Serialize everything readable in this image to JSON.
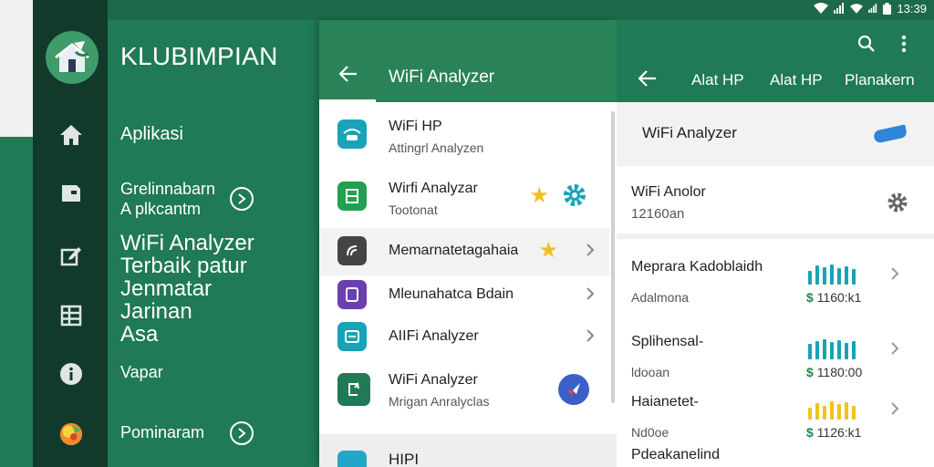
{
  "status_bar": {
    "time": "13:39"
  },
  "colors": {
    "primary": "#1f7a55",
    "dark_rail": "#123a2a",
    "star": "#f3c023",
    "teal": "#18a3b8"
  },
  "drawer": {
    "title": "KLUBIMPIAN",
    "aplikasi": "Aplikasi",
    "group1_line1": "Grelinnabarn",
    "group1_line2": "A plkcantm",
    "big_line1": "WiFi Analyzer",
    "big_line2": "Terbaik patur",
    "big_line3": "Jenmatar",
    "big_line4": "Jarinan",
    "big_line5": "Asa",
    "vapar": "Vapar",
    "pominaram": "Pominaram"
  },
  "middle": {
    "header_title": "WiFi Analyzer",
    "items": [
      {
        "title": "WiFi HP",
        "subtitle": "Attingrl Analyzen",
        "icon": "wifi-router-icon"
      },
      {
        "title": "Wirfi Analyzar",
        "subtitle": "Tootonat",
        "icon": "app-icon"
      },
      {
        "title": "Memarnatetagahaia",
        "icon": "signal-icon"
      },
      {
        "title": "Mleunahatca Bdain",
        "icon": "app-icon"
      },
      {
        "title": "AIIFi Analyzer",
        "icon": "app-icon"
      },
      {
        "title": "WiFi Analyzer",
        "subtitle": "Mrigan Anralyclas",
        "icon": "app-icon"
      }
    ],
    "bottom_label": "HIPI"
  },
  "right": {
    "tabs": [
      "Alat HP",
      "Alat HP",
      "Planakern"
    ],
    "section1_title": "WiFi Analyzer",
    "section2_title": "WiFi Anolor",
    "section2_sub": "12160an",
    "items": [
      {
        "title": "Meprara Kadoblaidh",
        "subtitle": "Adalmona",
        "dollar": "$",
        "price": "1160:k1",
        "bar_color": "#18a3b8",
        "bars": [
          0.7,
          0.95,
          0.85,
          1.0,
          0.8,
          0.9,
          0.75
        ]
      },
      {
        "title": "Splihensal-",
        "subtitle": "ldooan",
        "dollar": "$",
        "price": "1180:00",
        "bar_color": "#18a3b8",
        "bars": [
          0.75,
          0.9,
          1.0,
          0.85,
          0.95,
          0.8,
          0.9
        ]
      },
      {
        "title": "Haianetet-",
        "subtitle": "Nd0oe",
        "dollar": "$",
        "price": "1126:k1",
        "bar_color": "#f2c21b",
        "bars": [
          0.6,
          0.8,
          0.7,
          0.9,
          0.75,
          0.85,
          0.7
        ]
      }
    ],
    "last_item": "Pdeakanelind"
  }
}
